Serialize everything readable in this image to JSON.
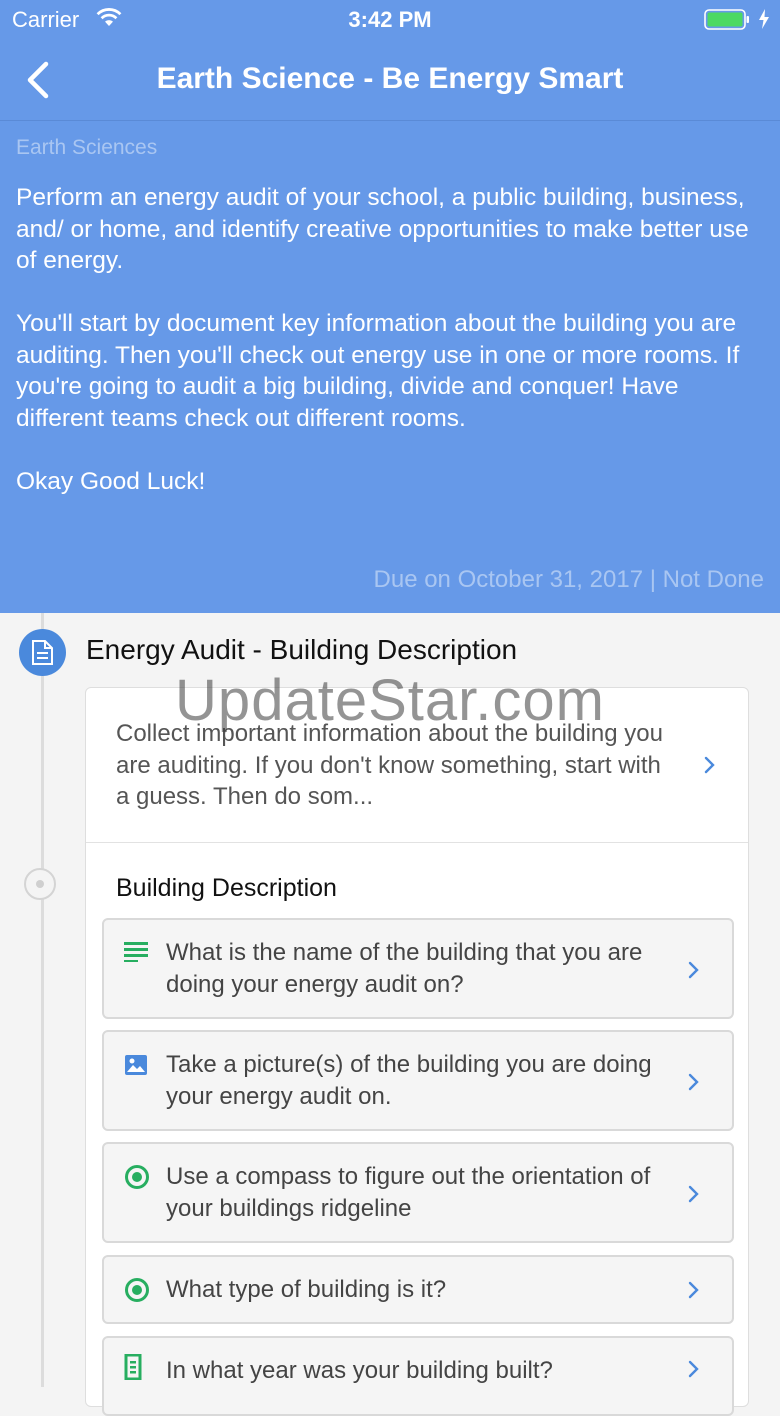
{
  "status_bar": {
    "carrier": "Carrier",
    "time": "3:42 PM",
    "battery_color": "#4cd964"
  },
  "nav": {
    "title": "Earth Science - Be Energy Smart",
    "back_icon": "chevron-left-icon"
  },
  "assignment": {
    "subject": "Earth Sciences",
    "paragraphs": [
      "Perform an energy audit of your school, a public building, business, and/ or home, and identify creative opportunities to make better use of energy.",
      "You'll start by document key information about the building you are auditing. Then you'll check out energy use in one or more rooms. If you're going to audit a big building, divide and conquer! Have different teams check out different rooms.",
      "Okay Good Luck!"
    ],
    "due": "Due on October 31, 2017 | Not Done"
  },
  "section": {
    "title": "Energy Audit - Building Description",
    "icon": "document-icon",
    "description": "Collect important information about the building you are auditing. If you don't know something, start with a guess. Then do som...",
    "group_title": "Building Description",
    "questions": [
      {
        "icon": "text-lines-icon",
        "text": "What is the name of the building that you are doing your energy audit on?"
      },
      {
        "icon": "image-icon",
        "text": "Take a picture(s) of the building you are doing your energy audit on."
      },
      {
        "icon": "radio-icon",
        "text": "Use a compass to figure out the orientation of your buildings ridgeline"
      },
      {
        "icon": "radio-icon",
        "text": "What type of building is it?"
      },
      {
        "icon": "number-field-icon",
        "text": "In what year was your building built?"
      }
    ]
  },
  "watermark": "UpdateStar.com",
  "colors": {
    "header": "#6699e8",
    "accent": "#4a89dc",
    "green": "#27ae60"
  }
}
